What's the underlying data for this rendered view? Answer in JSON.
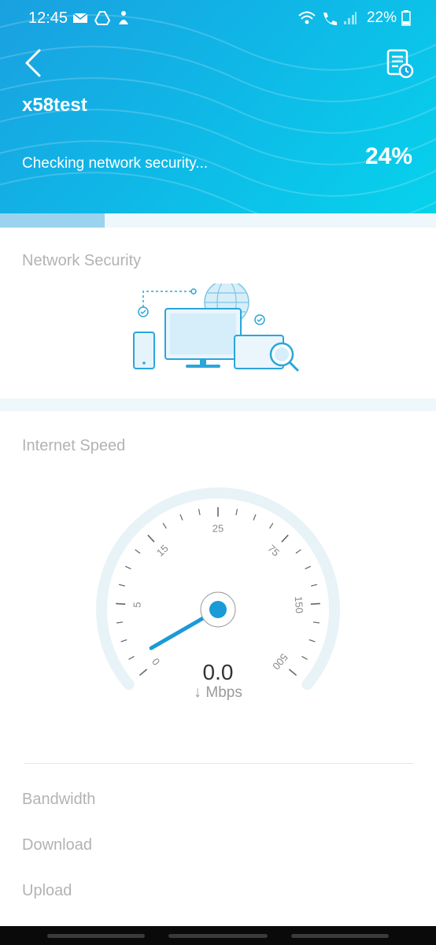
{
  "statusbar": {
    "time": "12:45",
    "battery": "22%"
  },
  "header": {
    "device_name": "x58test",
    "status_text": "Checking network security...",
    "progress_text": "24%",
    "progress_value": 0.24
  },
  "sections": {
    "network_security": "Network Security",
    "internet_speed": "Internet Speed"
  },
  "gauge": {
    "ticks": [
      "0",
      "5",
      "15",
      "25",
      "75",
      "150",
      "500"
    ],
    "value": "0.0",
    "unit": "Mbps"
  },
  "results": {
    "bandwidth": "Bandwidth",
    "download": "Download",
    "upload": "Upload"
  },
  "colors": {
    "accent": "#1a9ad6",
    "header_gradient_start": "#1aa0e0",
    "header_gradient_end": "#06d2ec",
    "muted_text": "#b3b3b3",
    "gauge_track": "#e8f3f8"
  },
  "icons": {
    "back": "back-arrow-icon",
    "history": "report-history-icon"
  }
}
